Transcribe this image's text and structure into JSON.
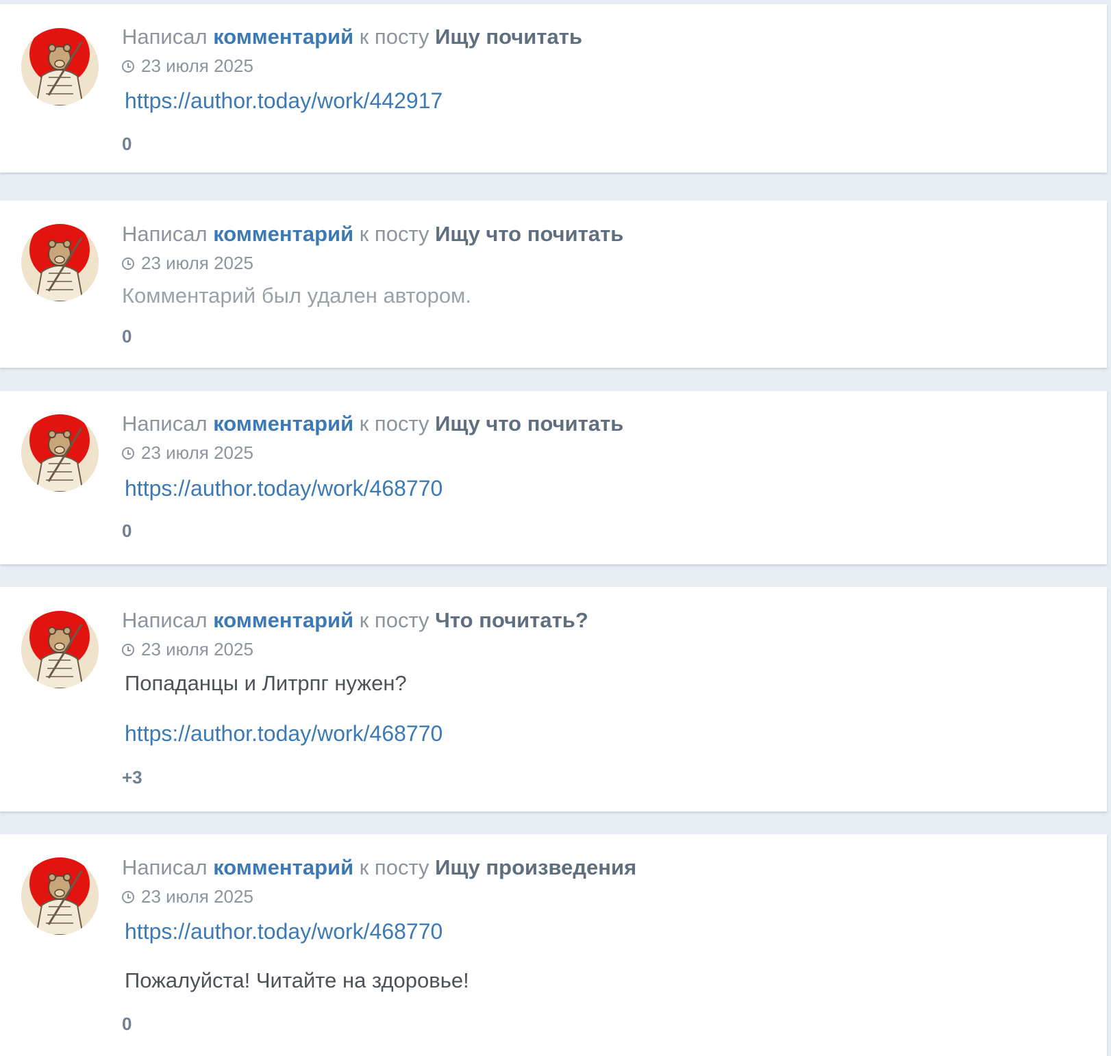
{
  "feed": {
    "items": [
      {
        "prefix": "Написал",
        "comment_link": "комментарий",
        "middle": "к посту",
        "post_title": "Ищу почитать",
        "date": "23 июля 2025",
        "link1": "https://author.today/work/442917",
        "rating": "0"
      },
      {
        "prefix": "Написал",
        "comment_link": "комментарий",
        "middle": "к посту",
        "post_title": "Ищу что почитать",
        "date": "23 июля 2025",
        "deleted_text": "Комментарий был удален автором.",
        "rating": "0"
      },
      {
        "prefix": "Написал",
        "comment_link": "комментарий",
        "middle": "к посту",
        "post_title": "Ищу что почитать",
        "date": "23 июля 2025",
        "link1": "https://author.today/work/468770",
        "rating": "0"
      },
      {
        "prefix": "Написал",
        "comment_link": "комментарий",
        "middle": "к посту",
        "post_title": "Что почитать?",
        "date": "23 июля 2025",
        "text1": "Попаданцы и Литрпг нужен?",
        "link1": "https://author.today/work/468770",
        "rating": "+3"
      },
      {
        "prefix": "Написал",
        "comment_link": "комментарий",
        "middle": "к посту",
        "post_title": "Ищу произведения",
        "date": "23 июля 2025",
        "link1": "https://author.today/work/468770",
        "text1": "Пожалуйста! Читайте на здоровье!",
        "rating": "0"
      }
    ]
  },
  "colors": {
    "background": "#e8edf4",
    "card": "#ffffff",
    "link": "#3c7ab5",
    "post_title": "#5f6f80",
    "muted": "#8c959f",
    "avatar_sun": "#e3140f"
  },
  "icons": {
    "date": "clock-icon",
    "avatar": "user-avatar"
  }
}
